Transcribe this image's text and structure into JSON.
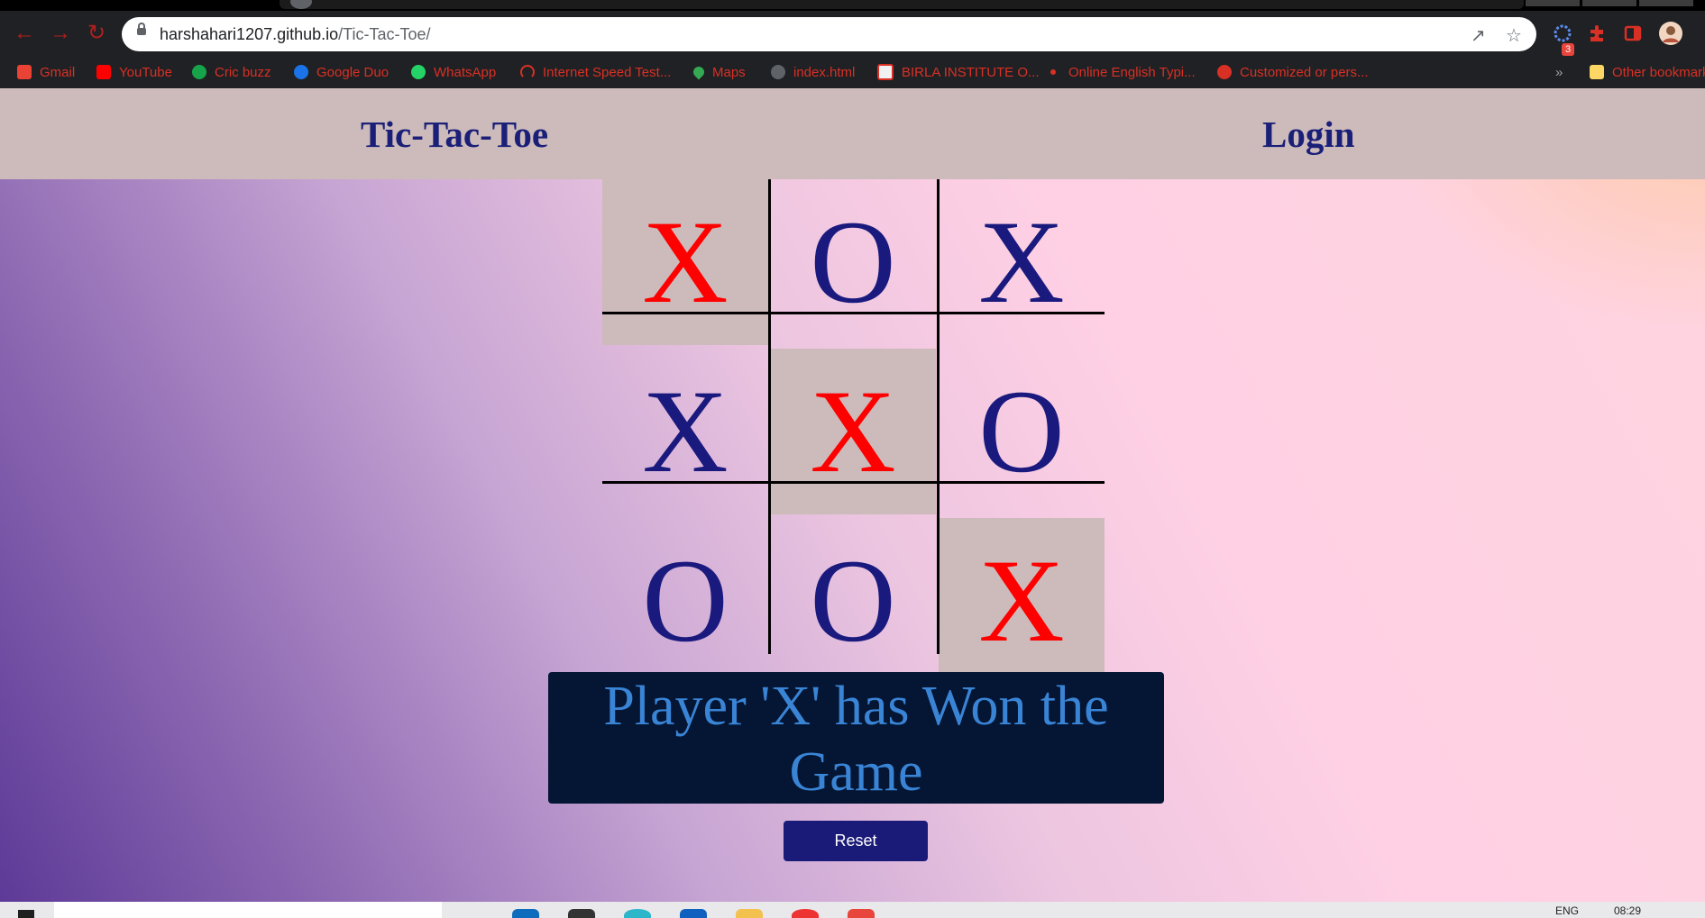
{
  "browser": {
    "url_host": "harshahari1207.github.io",
    "url_path": "/Tic-Tac-Toe/",
    "extension_badge": "3",
    "bookmarks": [
      {
        "label": "Gmail",
        "icon": "gmail-icon",
        "color": "#ea4335"
      },
      {
        "label": "YouTube",
        "icon": "youtube-icon",
        "color": "#ff0000"
      },
      {
        "label": "Cric buzz",
        "icon": "cricbuzz-icon",
        "color": "#17a34a"
      },
      {
        "label": "Google Duo",
        "icon": "google-duo-icon",
        "color": "#1a73e8"
      },
      {
        "label": "WhatsApp",
        "icon": "whatsapp-icon",
        "color": "#25d366"
      },
      {
        "label": "Internet Speed Test...",
        "icon": "speedometer-icon",
        "color": "#d93025"
      },
      {
        "label": "Maps",
        "icon": "maps-pin-icon",
        "color": "#34a853"
      },
      {
        "label": "index.html",
        "icon": "globe-icon",
        "color": "#5f6368"
      },
      {
        "label": "BIRLA INSTITUTE O...",
        "icon": "bits-icon",
        "color": "#f1f1f1"
      },
      {
        "label": "Online English Typi...",
        "icon": "typing-icon",
        "color": "#d93025"
      },
      {
        "label": "Customized or pers...",
        "icon": "gift-icon",
        "color": "#d93025"
      }
    ],
    "more_bookmarks": "»",
    "other_bookmarks": "Other bookmarks"
  },
  "header": {
    "title": "Tic-Tac-Toe",
    "login": "Login"
  },
  "board": {
    "cells": [
      {
        "mark": "X",
        "color": "#ff0000",
        "highlighted": true
      },
      {
        "mark": "O",
        "color": "#1a1a7e",
        "highlighted": false
      },
      {
        "mark": "X",
        "color": "#1a1a7e",
        "highlighted": false
      },
      {
        "mark": "X",
        "color": "#1a1a7e",
        "highlighted": false
      },
      {
        "mark": "X",
        "color": "#ff0000",
        "highlighted": true
      },
      {
        "mark": "O",
        "color": "#1a1a7e",
        "highlighted": false
      },
      {
        "mark": "O",
        "color": "#1a1a7e",
        "highlighted": false
      },
      {
        "mark": "O",
        "color": "#1a1a7e",
        "highlighted": false
      },
      {
        "mark": "X",
        "color": "#ff0000",
        "highlighted": true
      }
    ],
    "highlight_color": "#cdbaba"
  },
  "result": {
    "message": "Player 'X' has Won the Game"
  },
  "reset": {
    "label": "Reset"
  },
  "taskbar": {
    "language": "ENG",
    "time": "08:29"
  }
}
